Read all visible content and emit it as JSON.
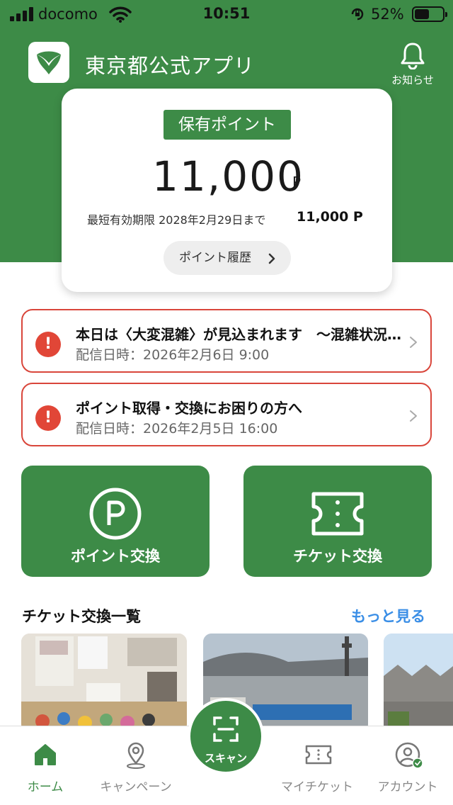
{
  "status_bar": {
    "carrier": "docomo",
    "time": "10:51",
    "battery_percent": "52%"
  },
  "header": {
    "app_title": "東京都公式アプリ",
    "notice_label": "お知らせ"
  },
  "point_card": {
    "badge": "保有ポイント",
    "points": "11,000",
    "unit": "P",
    "expiry_text": "最短有効期限  2028年2月29日まで",
    "expiry_points": "11,000 P",
    "history_button": "ポイント履歴"
  },
  "notices": [
    {
      "title": "本日は〈大変混雑〉が見込まれます　〜混雑状況について〜",
      "date": "配信日時：2026年2月6日 9:00"
    },
    {
      "title": "ポイント取得・交換にお困りの方へ",
      "date": "配信日時：2026年2月5日 16:00"
    }
  ],
  "actions": {
    "point_exchange": "ポイント交換",
    "ticket_exchange": "チケット交換"
  },
  "ticket_section": {
    "title": "チケット交換一覧",
    "see_more": "もっと見る"
  },
  "tab_bar": {
    "home": "ホーム",
    "campaign": "キャンペーン",
    "scan": "スキャン",
    "my_ticket": "マイチケット",
    "account": "アカウント"
  },
  "colors": {
    "brand_green": "#3d8b47",
    "alert_red": "#d9463b",
    "link_blue": "#3a8ee6"
  }
}
